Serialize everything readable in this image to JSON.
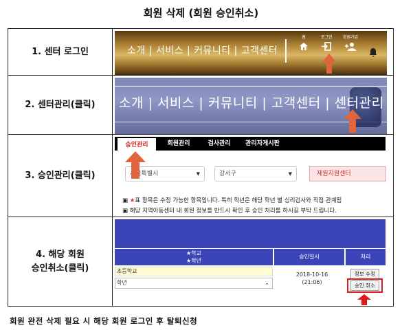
{
  "title": "회원 삭제 (회원 승인취소)",
  "steps": [
    {
      "label": "1. 센터 로그인"
    },
    {
      "label": "2. 센터관리(클릭)"
    },
    {
      "label": "3. 승인관리(클릭)"
    },
    {
      "label_line1": "4. 해당 회원",
      "label_line2": "승인취소(클릭)"
    }
  ],
  "nav1": {
    "menu": "소개 | 서비스 | 커뮤니티 | 고객센터",
    "home_label": "홈",
    "login_label": "로그인",
    "join_label": "회원가입"
  },
  "nav2": {
    "menu": "소개 | 서비스 | 커뮤니티 | 고객센터 | 센터관리"
  },
  "admin": {
    "tabs": [
      "승인관리",
      "회원관리",
      "검사관리",
      "관리자게시판"
    ],
    "region_select": "서울특별시",
    "district_select": "강서구",
    "center_name": "제원지원센터",
    "note1_prefix": "▣ ",
    "note1_star": "★",
    "note1_text": "표 항목은 수정 가능한 항목입니다. 특히 학년은 해당 학년 별 심리검사와 직접 관계됩",
    "note2": "▣ 해당 지역아동센터 내 회원 정보를 반드시 확인 후 승인 처리를 하시길 부탁 드립니다."
  },
  "member_table": {
    "col_school_line1": "★학교",
    "col_school_line2": "★학년",
    "col_date": "승인일시",
    "col_action": "처리",
    "school_value": "초등학교",
    "grade_value": "학년",
    "date_value": "2018-10-16",
    "time_value": "(21:06)",
    "edit_button": "정보 수정",
    "cancel_button": "승인 취소"
  },
  "footer": "회원 완전 삭제 필요 시 해당 회원 로그인 후 탈퇴신청",
  "colors": {
    "arrow": "#e0653c",
    "nav_blue": "#3b45b8",
    "highlight_red": "#e01818"
  }
}
